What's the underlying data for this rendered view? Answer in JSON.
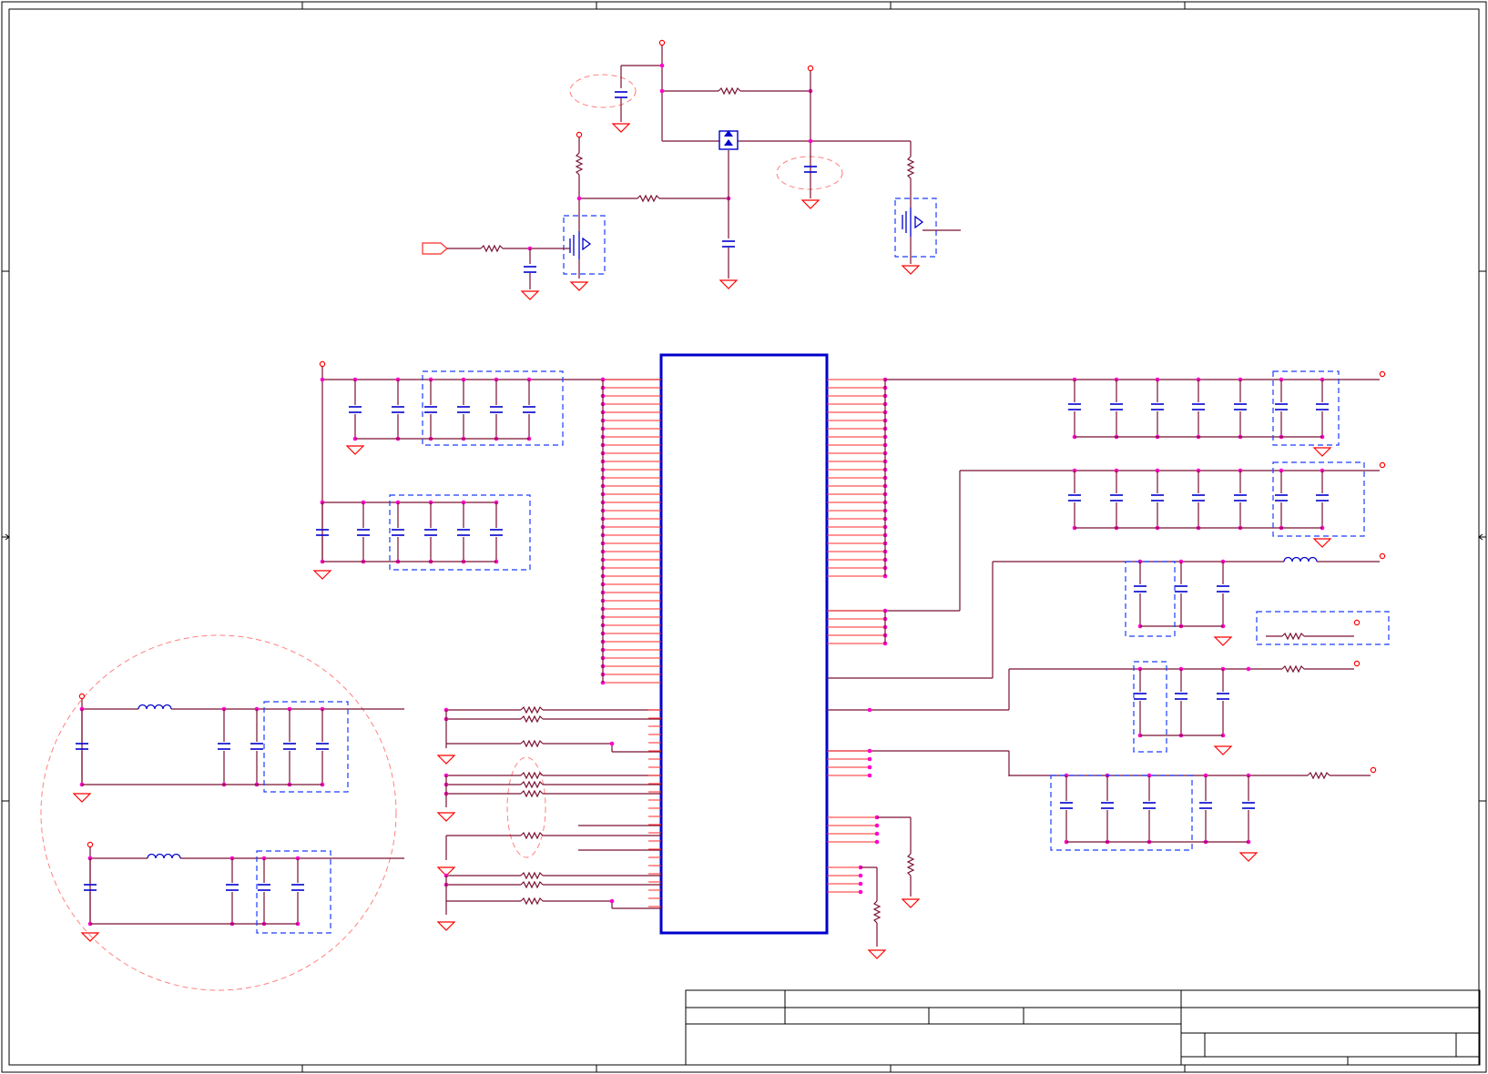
{
  "colors": {
    "wire": "#7a1030",
    "pin": "#ff2a2a",
    "component": "#0000cc",
    "junction": "#ff00cc",
    "ground": "#ff0000",
    "group_box": "#1a3cff",
    "highlight": "#ff8080",
    "frame": "#000000"
  },
  "sheet": {
    "icons": [
      "ground-icon",
      "power-port-icon",
      "capacitor-icon",
      "resistor-icon",
      "inductor-icon",
      "mosfet-icon",
      "diode-icon",
      "connector-icon"
    ]
  }
}
